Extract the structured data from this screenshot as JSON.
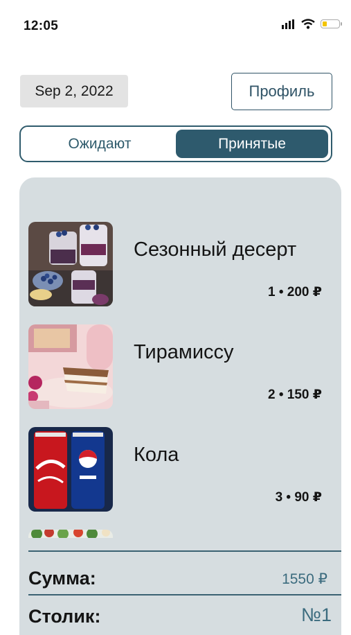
{
  "status_bar": {
    "time": "12:05",
    "battery_color": "#f2c400"
  },
  "header": {
    "date": "Sep 2, 2022",
    "profile_label": "Профиль"
  },
  "tabs": [
    {
      "label": "Ожидают",
      "active": false
    },
    {
      "label": "Принятые",
      "active": true
    }
  ],
  "orders": [
    {
      "name": "Сезонный десерт",
      "qty_price": "1 • 200 ₽",
      "image": "berry-dessert-image"
    },
    {
      "name": "Тирамиссу",
      "qty_price": "2 • 150 ₽",
      "image": "tiramisu-image"
    },
    {
      "name": "Кола",
      "qty_price": "3 • 90 ₽",
      "image": "cola-pepsi-cans-image"
    },
    {
      "name": "",
      "qty_price": "",
      "image": "salad-image"
    }
  ],
  "summary": {
    "sum_label": "Сумма:",
    "sum_value": "1550 ₽",
    "table_label": "Столик:",
    "table_value": "№1"
  },
  "colors": {
    "accent": "#2e5a6d",
    "panel": "#d6dde0",
    "value_text": "#3b6b7e"
  }
}
